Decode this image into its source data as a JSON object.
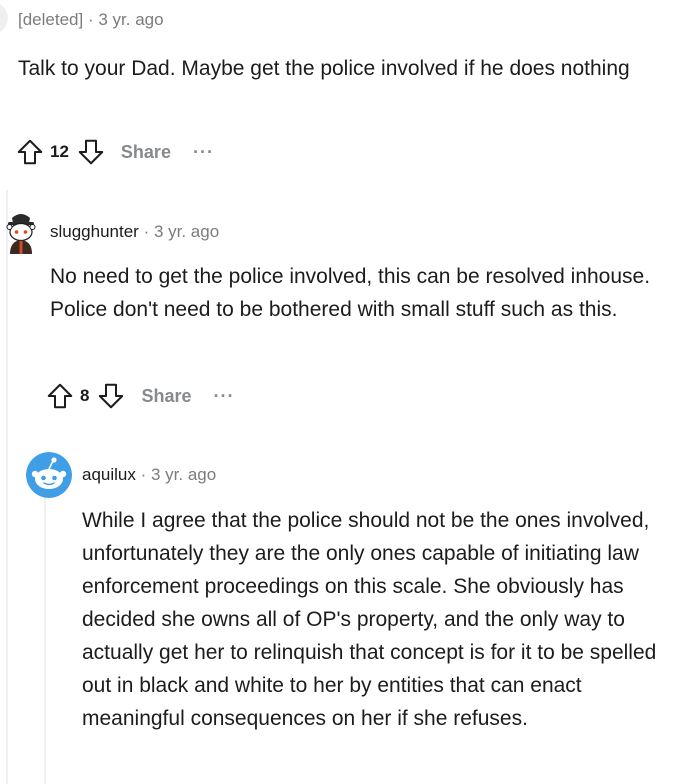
{
  "comments": [
    {
      "author": "[deleted]",
      "separator": " · ",
      "time": "3 yr. ago",
      "body": "Talk to your Dad. Maybe get the police involved if he does nothing",
      "score": "12",
      "share_label": "Share",
      "more_label": "···"
    },
    {
      "author": "slugghunter",
      "separator": " · ",
      "time": "3 yr. ago",
      "body": "No need to get the police involved, this can be resolved inhouse. Police don't need to be bothered with small stuff such as this.",
      "score": "8",
      "share_label": "Share",
      "more_label": "···"
    },
    {
      "author": "aquilux",
      "separator": " · ",
      "time": "3 yr. ago",
      "body": "While I agree that the police should not be the ones involved, unfortunately they are the only ones capable of initiating law enforcement proceedings on this scale. She obviously has decided she owns all of OP's property, and the only way to actually get her to relinquish that concept is for it to be spelled out in black and white to her by entities that can enact meaningful consequences on her if she refuses."
    }
  ],
  "colors": {
    "text": "#1c1c1c",
    "meta": "#7c7c7c",
    "action": "#878a8c",
    "thread_line": "#edeff1",
    "avatar_blue": "#3f9ee6"
  },
  "icons": [
    "upvote-icon",
    "downvote-icon",
    "more-icon"
  ]
}
